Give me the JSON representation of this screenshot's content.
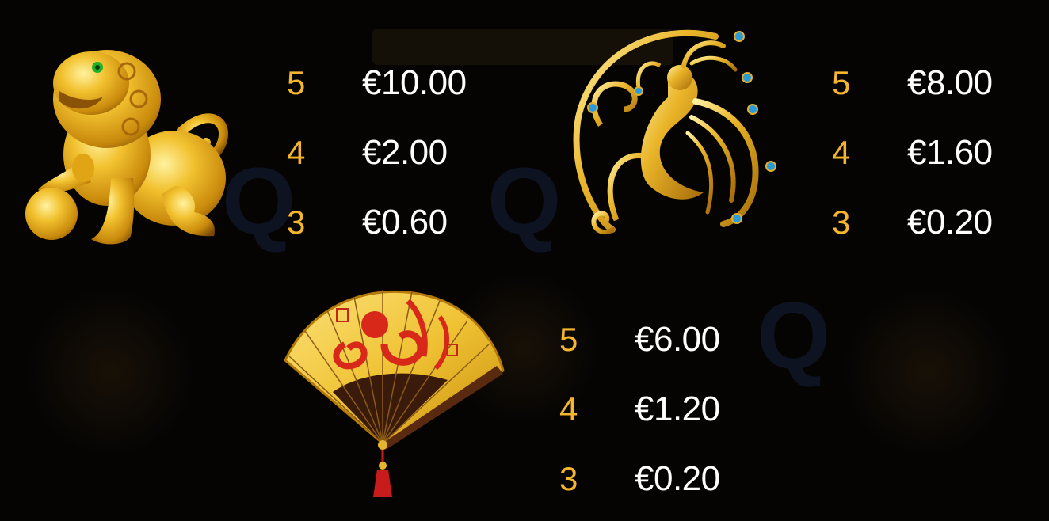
{
  "symbols": [
    {
      "name": "golden-lion",
      "icon": "golden-lion-statue-icon",
      "pays": [
        {
          "count": "5",
          "amount": "€10.00"
        },
        {
          "count": "4",
          "amount": "€2.00"
        },
        {
          "count": "3",
          "amount": "€0.60"
        }
      ]
    },
    {
      "name": "golden-phoenix",
      "icon": "golden-phoenix-medallion-icon",
      "pays": [
        {
          "count": "5",
          "amount": "€8.00"
        },
        {
          "count": "4",
          "amount": "€1.60"
        },
        {
          "count": "3",
          "amount": "€0.20"
        }
      ]
    },
    {
      "name": "golden-fan",
      "icon": "golden-fan-with-dragon-icon",
      "pays": [
        {
          "count": "5",
          "amount": "€6.00"
        },
        {
          "count": "4",
          "amount": "€1.20"
        },
        {
          "count": "3",
          "amount": "€0.20"
        }
      ]
    }
  ],
  "colors": {
    "count": "#f5b52e",
    "amount": "#ffffff",
    "background": "#050403",
    "gold": "#e8b21c"
  }
}
